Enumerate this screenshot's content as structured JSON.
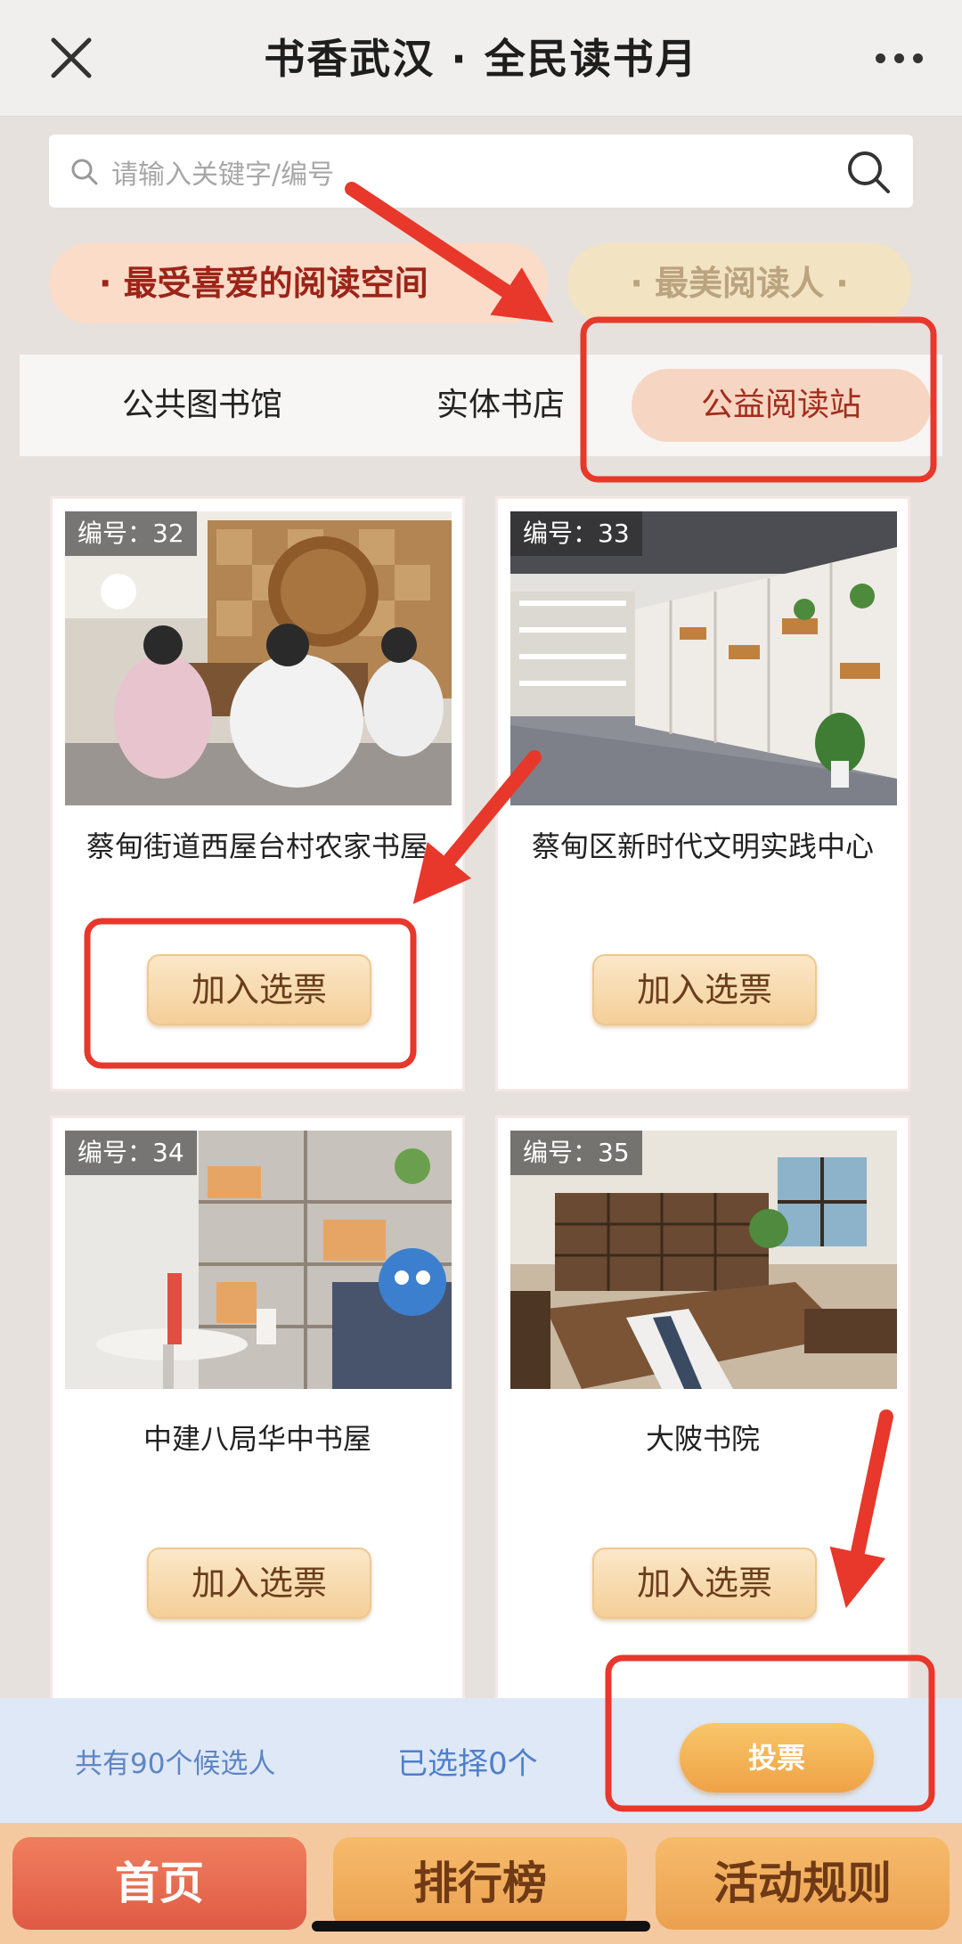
{
  "header": {
    "title": "书香武汉 · 全民读书月"
  },
  "search": {
    "placeholder": "请输入关键字/编号"
  },
  "award_tabs": [
    {
      "label": "· 最受喜爱的阅读空间",
      "active": true
    },
    {
      "label": "· 最美阅读人 ·",
      "active": false
    }
  ],
  "categories": [
    {
      "label": "公共图书馆",
      "active": false
    },
    {
      "label": "实体书店",
      "active": false
    },
    {
      "label": "公益阅读站",
      "active": true
    }
  ],
  "candidates": [
    {
      "badge": "编号：32",
      "name": "蔡甸街道西屋台村农家书屋",
      "button": "加入选票"
    },
    {
      "badge": "编号：33",
      "name": "蔡甸区新时代文明实践中心",
      "button": "加入选票"
    },
    {
      "badge": "编号：34",
      "name": "中建八局华中书屋",
      "button": "加入选票"
    },
    {
      "badge": "编号：35",
      "name": "大陂书院",
      "button": "加入选票"
    }
  ],
  "summary": {
    "total": "共有90个候选人",
    "selected": "已选择0个",
    "vote": "投票"
  },
  "bottom_nav": [
    {
      "label": "首页",
      "active": true
    },
    {
      "label": "排行榜",
      "active": false
    },
    {
      "label": "活动规则",
      "active": false
    }
  ],
  "colors": {
    "accent_red": "#e05a45",
    "annotation_red": "#e8372b",
    "button_gold": "#f4cf98"
  }
}
